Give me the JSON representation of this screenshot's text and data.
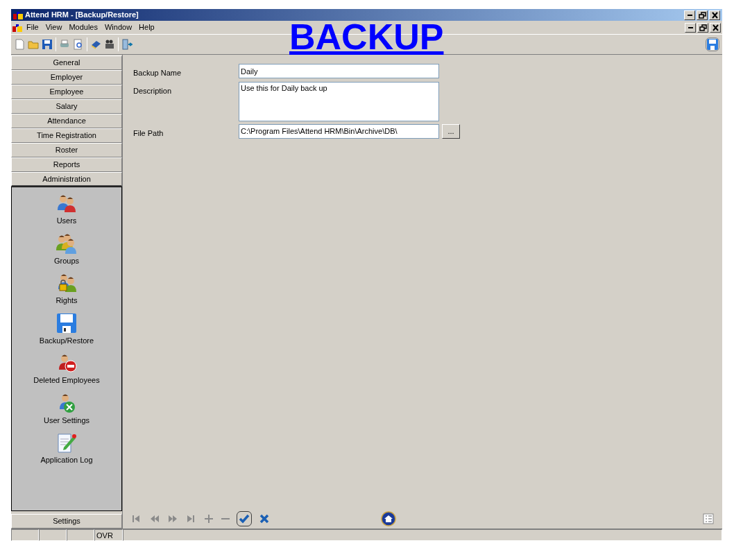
{
  "window": {
    "title": "Attend HRM - [Backup/Restore]"
  },
  "menu": [
    "File",
    "View",
    "Modules",
    "Window",
    "Help"
  ],
  "overlay_caption": "BACKUP",
  "sidebar": {
    "sections": [
      {
        "label": "General",
        "selected": false
      },
      {
        "label": "Employer",
        "selected": false
      },
      {
        "label": "Employee",
        "selected": false
      },
      {
        "label": "Salary",
        "selected": false
      },
      {
        "label": "Attendance",
        "selected": false
      },
      {
        "label": "Time Registration",
        "selected": false
      },
      {
        "label": "Roster",
        "selected": false
      },
      {
        "label": "Reports",
        "selected": false
      },
      {
        "label": "Administration",
        "selected": true
      }
    ],
    "items": [
      {
        "label": "Users",
        "kind": "users"
      },
      {
        "label": "Groups",
        "kind": "groups"
      },
      {
        "label": "Rights",
        "kind": "rights"
      },
      {
        "label": "Backup/Restore",
        "kind": "floppy"
      },
      {
        "label": "Deleted Employees",
        "kind": "deleted"
      },
      {
        "label": "User Settings",
        "kind": "usersettings"
      },
      {
        "label": "Application Log",
        "kind": "log"
      }
    ],
    "footer": "Settings"
  },
  "form": {
    "fields": [
      {
        "label": "Backup Name",
        "value": "Daily",
        "kind": "text"
      },
      {
        "label": "Description",
        "value": "Use this for Daily back up",
        "kind": "textarea"
      },
      {
        "label": "File Path",
        "value": "C:\\Program Files\\Attend HRM\\Bin\\Archive\\DB\\",
        "kind": "path",
        "button": "..."
      }
    ]
  },
  "status_bar": {
    "mode": "OVR"
  }
}
